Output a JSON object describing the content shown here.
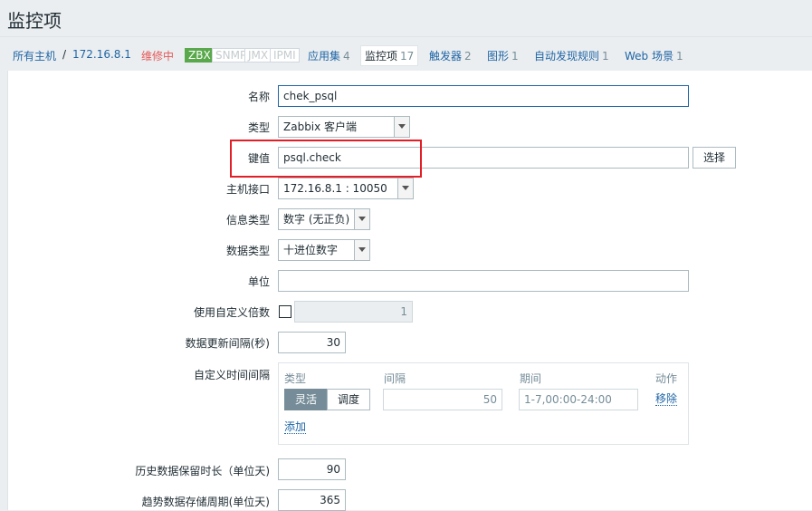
{
  "page": {
    "title": "监控项"
  },
  "nav": {
    "all_hosts": "所有主机",
    "separator": "/",
    "host": "172.16.8.1",
    "maintenance": "维修中",
    "badges": [
      {
        "label": "ZBX",
        "active": true
      },
      {
        "label": "SNMP",
        "active": false
      },
      {
        "label": "JMX",
        "active": false
      },
      {
        "label": "IPMI",
        "active": false
      }
    ],
    "tabs": [
      {
        "label": "应用集",
        "count": "4"
      },
      {
        "label": "监控项",
        "count": "17",
        "active": true
      },
      {
        "label": "触发器",
        "count": "2"
      },
      {
        "label": "图形",
        "count": "1"
      },
      {
        "label": "自动发现规则",
        "count": "1"
      },
      {
        "label": "Web 场景",
        "count": "1"
      }
    ]
  },
  "form": {
    "name": {
      "label": "名称",
      "value": "chek_psql"
    },
    "type": {
      "label": "类型",
      "value": "Zabbix 客户端"
    },
    "key": {
      "label": "键值",
      "value": "psql.check",
      "button": "选择"
    },
    "interface": {
      "label": "主机接口",
      "value": "172.16.8.1 : 10050"
    },
    "info_type": {
      "label": "信息类型",
      "value": "数字 (无正负)"
    },
    "data_type": {
      "label": "数据类型",
      "value": "十进位数字"
    },
    "units": {
      "label": "单位",
      "value": ""
    },
    "multiplier": {
      "label": "使用自定义倍数",
      "checked": false,
      "value": "1"
    },
    "delay": {
      "label": "数据更新间隔(秒)",
      "value": "30"
    },
    "flex": {
      "label": "自定义时间间隔",
      "headers": {
        "type": "类型",
        "interval": "间隔",
        "period": "期间",
        "action": "动作"
      },
      "type_options": [
        "灵活",
        "调度"
      ],
      "selected_type": "灵活",
      "interval_value": "50",
      "period_placeholder": "1-7,00:00-24:00",
      "remove": "移除",
      "add": "添加"
    },
    "history": {
      "label": "历史数据保留时长（单位天)",
      "value": "90"
    },
    "trends": {
      "label": "趋势数据存储周期(单位天)",
      "value": "365"
    }
  },
  "colors": {
    "accent": "#1f65a6",
    "highlight": "#e21f27",
    "maintenance": "#e45959",
    "zbx": "#59a84b"
  }
}
